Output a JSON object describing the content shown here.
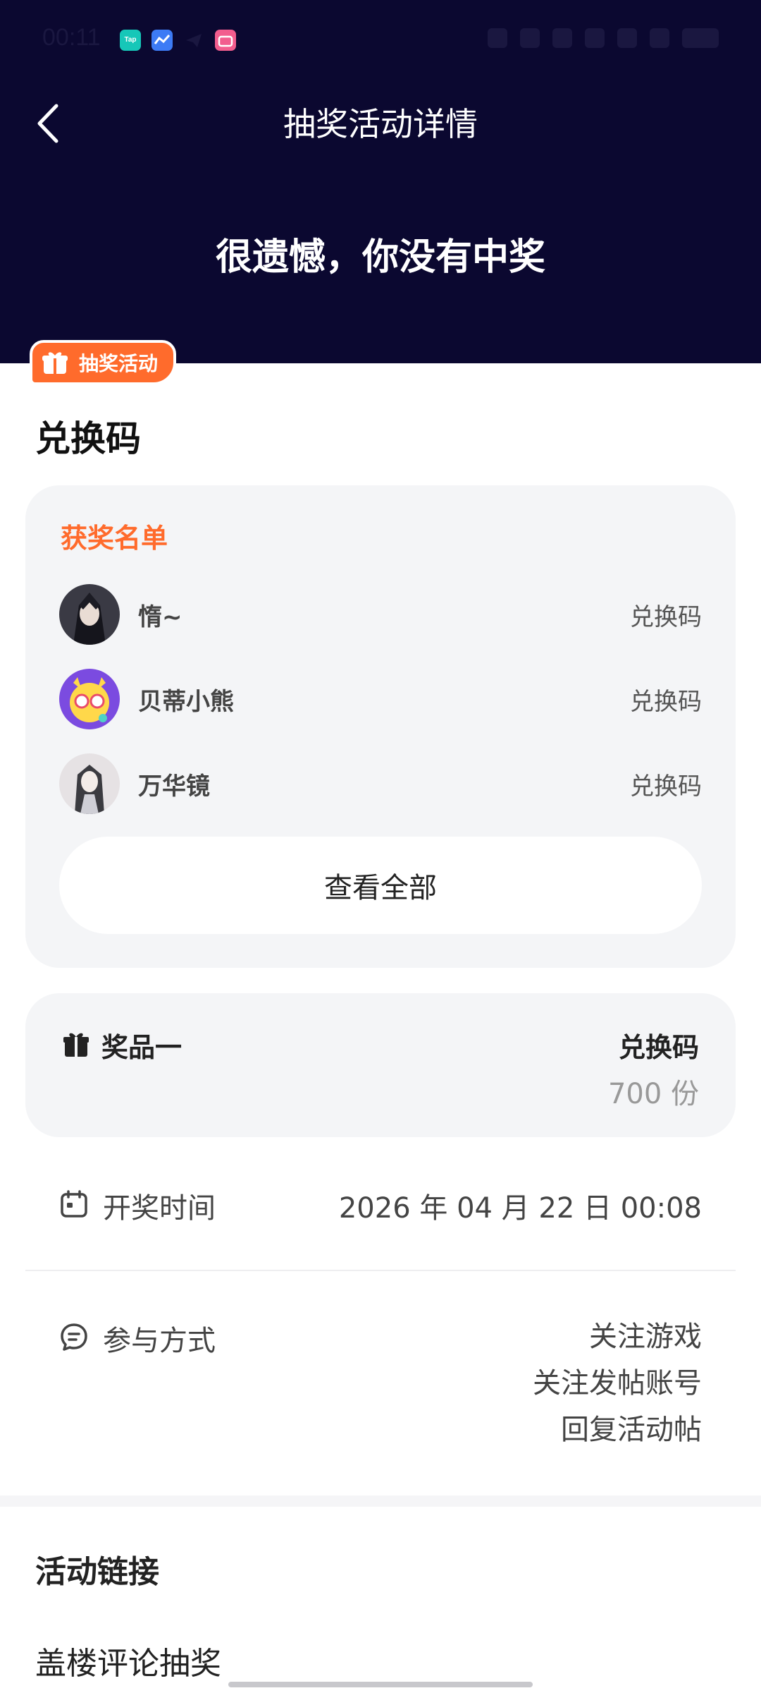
{
  "status_bar": {
    "time": "00:11",
    "apps": [
      {
        "icon": "taptap-app-icon",
        "label": "Tap",
        "color": "#16c7b8"
      },
      {
        "icon": "chart-app-icon",
        "label": "",
        "color": "#3d7bf5"
      },
      {
        "icon": "telegram-icon",
        "label": "",
        "color": "#1a1740"
      },
      {
        "icon": "bilibili-icon",
        "label": "",
        "color": "#f25d8e"
      }
    ]
  },
  "header": {
    "back_icon": "chevron-left-icon",
    "title": "抽奖活动详情",
    "result": "很遗憾，你没有中奖",
    "background": "#0b0830"
  },
  "badge": {
    "label": "抽奖活动",
    "color": "#ff6b2c"
  },
  "prize_title": "兑换码",
  "winners": {
    "heading": "获奖名单",
    "items": [
      {
        "name": "惰~",
        "prize": "兑换码"
      },
      {
        "name": "贝蒂小熊",
        "prize": "兑换码"
      },
      {
        "name": "万华镜",
        "prize": "兑换码"
      }
    ],
    "view_all": "查看全部"
  },
  "prize": {
    "label": "奖品一",
    "name": "兑换码",
    "quantity": "700 份"
  },
  "draw_time": {
    "label": "开奖时间",
    "value": "2026 年 04 月 22 日 00:08"
  },
  "participation": {
    "label": "参与方式",
    "methods": [
      "关注游戏",
      "关注发帖账号",
      "回复活动帖"
    ]
  },
  "links": {
    "title": "活动链接",
    "items": [
      "盖楼评论抽奖"
    ]
  },
  "colors": {
    "accent": "#ff6b2c",
    "card_bg": "#f4f5f7"
  }
}
